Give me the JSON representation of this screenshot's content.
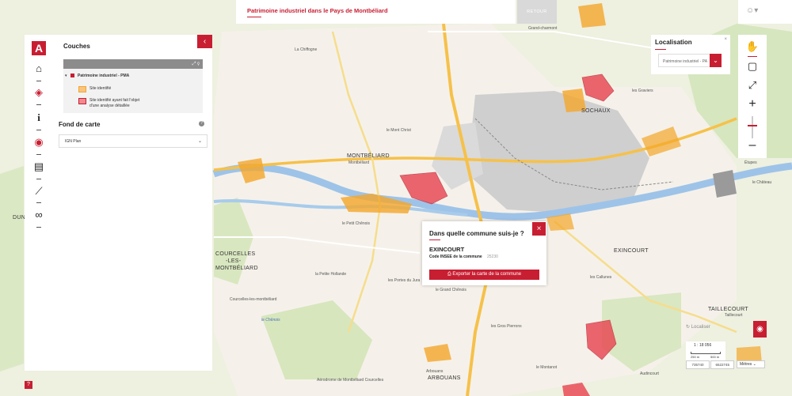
{
  "header": {
    "title": "Patrimoine industriel dans le Pays de Montbéliard",
    "back_label": "RETOUR"
  },
  "colors": {
    "accent": "#c81e32",
    "orange_sites": "#f4a62a",
    "red_sites": "#e8424e"
  },
  "rail": {
    "logo_letter": "A",
    "items": [
      {
        "name": "home-icon",
        "glyph": "⌂"
      },
      {
        "name": "layers-icon",
        "glyph": "◈"
      },
      {
        "name": "info-icon",
        "glyph": "i"
      },
      {
        "name": "map-pin-icon",
        "glyph": "⌖"
      },
      {
        "name": "print-icon",
        "glyph": "▤"
      },
      {
        "name": "ruler-icon",
        "glyph": "⟋"
      },
      {
        "name": "link-icon",
        "glyph": "∞"
      }
    ],
    "help": "?"
  },
  "panel": {
    "title": "Couches",
    "layer_group": "Patrimoine industriel - PMA",
    "legend": [
      {
        "label": "Site identifié"
      },
      {
        "label_line1": "Site identifié ayant fait l'objet",
        "label_line2": "d'une analyse détaillée"
      }
    ],
    "basemap_title": "Fond de carte",
    "basemap_value": "IGN Plan"
  },
  "localisation": {
    "title": "Localisation",
    "close": "×",
    "input_value": "Patrimoine industriel - PA"
  },
  "popup": {
    "heading": "Dans quelle commune suis-je ?",
    "commune": "EXINCOURT",
    "code_label": "Code INSEE de la commune",
    "code_value": "25230",
    "export_label": "Exporter la carte de la commune"
  },
  "scale": {
    "locate_label": "Localiser",
    "ratio": "1 : 18 056",
    "left_tick": "250 m",
    "right_tick": "500 m",
    "x": "735740",
    "y": "6522745",
    "unit": "Mètres"
  },
  "map_labels": {
    "montbeliard": "MONTBÉLIARD",
    "montbeliard_sub": "Montbéliard",
    "courcelles1": "COURCELLES",
    "courcelles2": "-LES-",
    "courcelles3": "MONTBÉLIARD",
    "courcelles_town": "Courcelles-les-montbéliard",
    "exincourt": "EXINCOURT",
    "taillecourt": "TAILLECOURT",
    "taillecourt_sub": "Taillecourt",
    "arbouans": "Arbouans",
    "arbouans_caps": "ARBOUANS",
    "audincourt": "Audincourt",
    "sochaux": "SOCHAUX",
    "etupes": "Étupes",
    "grand_charmont": "Grand-charmont",
    "chiffogne": "La Chiffogne",
    "mont_christ": "le Mont Christ",
    "petit_chenois": "le Petit Chênois",
    "petite_hollande": "la Petite Hollande",
    "grand_chenois": "le Grand Chênois",
    "gros_pierrons": "les Gros Pierrons",
    "montanot": "le Montanot",
    "chateau": "le Château",
    "coteau_jouvent": "Coteau Jouvent",
    "portes_jura": "les Portes du Jura",
    "callunes": "les Callunes",
    "gravieris": "les Graviers",
    "aerodrome": "Aérodrome de Montbéliard Courcelles",
    "allan": "le Chênois",
    "dung": "DUNG"
  }
}
